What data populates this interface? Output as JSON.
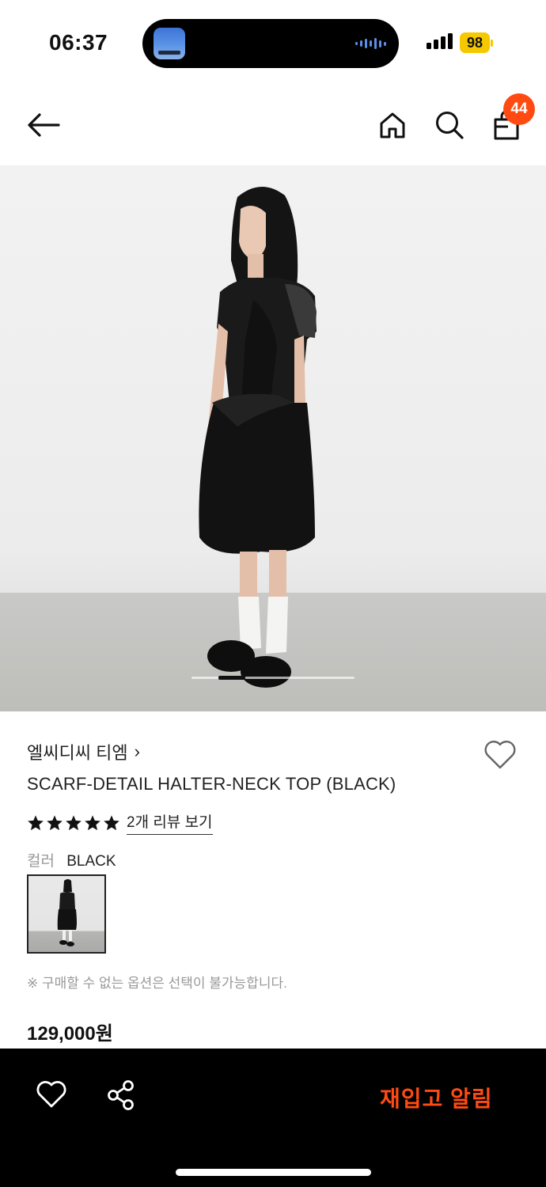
{
  "status_bar": {
    "time": "06:37",
    "battery": "98",
    "battery_color": "#f5c800"
  },
  "nav": {
    "back_icon": "arrow-left-icon",
    "home_icon": "home-icon",
    "search_icon": "search-icon",
    "bag_icon": "shopping-bag-icon",
    "cart_count": "44",
    "badge_color": "#ff4b11"
  },
  "gallery": {
    "image": "model-wearing-black-halter-top"
  },
  "product": {
    "brand": "엘씨디씨 티엠",
    "brand_chevron": "›",
    "title": "SCARF-DETAIL HALTER-NECK TOP (BLACK)",
    "rating_stars": 5,
    "review_link": "2개 리뷰 보기",
    "color_label": "컬러",
    "color_value": "BLACK",
    "notice": "※ 구매할 수 없는 옵션은 선택이 불가능합니다.",
    "price": "129,000원"
  },
  "bottom_bar": {
    "like_icon": "heart-icon",
    "share_icon": "share-icon",
    "restock_label": "재입고 알림",
    "accent_color": "#ff4b11"
  }
}
